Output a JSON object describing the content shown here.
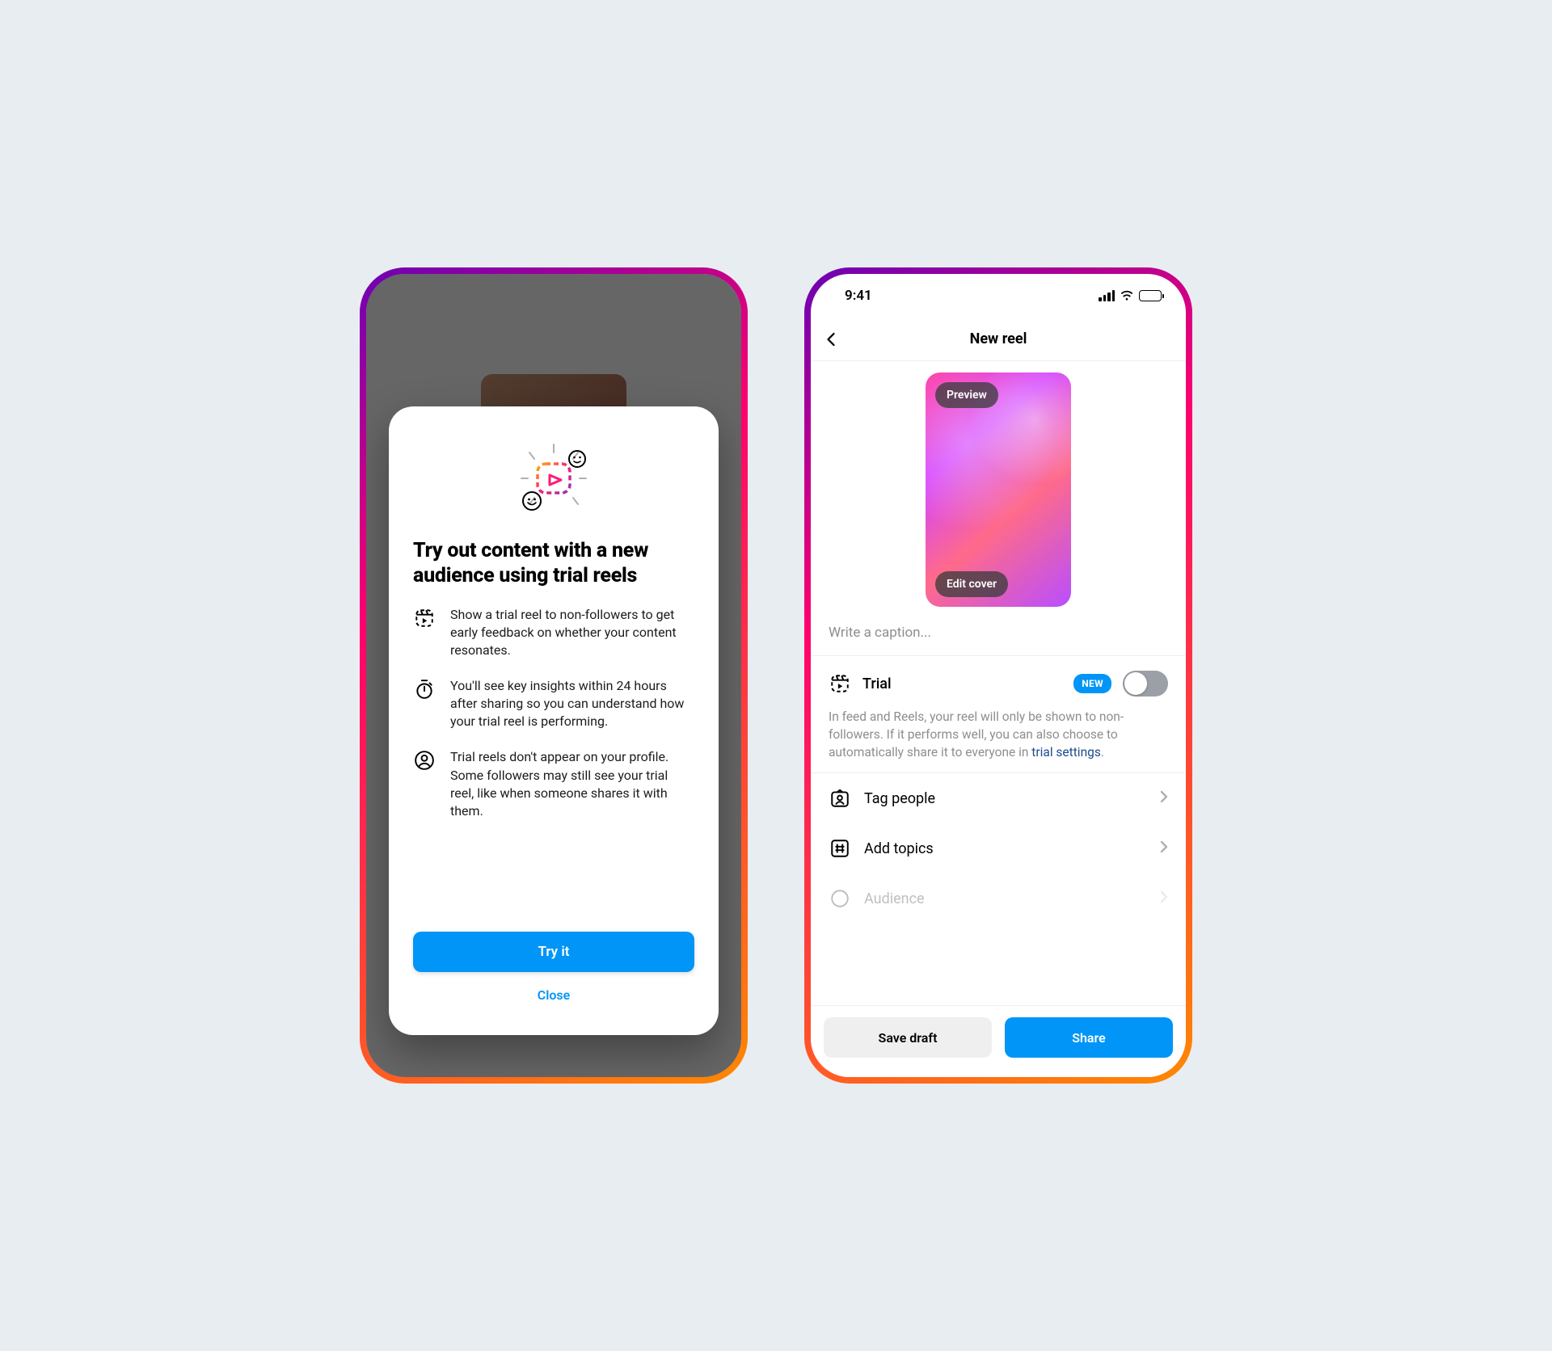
{
  "status": {
    "time": "9:41"
  },
  "nav": {
    "title": "New reel"
  },
  "modal": {
    "title": "Try out content with a new audience using trial reels",
    "bullets": [
      "Show a trial reel to non-followers to get early feedback on whether your content resonates.",
      "You'll see key insights within 24 hours after sharing so you can understand how your trial reel is performing.",
      "Trial reels don't appear on your profile. Some followers may still see your trial reel, like when someone shares it with them."
    ],
    "try_label": "Try it",
    "close_label": "Close"
  },
  "cover": {
    "preview_label": "Preview",
    "edit_label": "Edit cover"
  },
  "caption_placeholder": "Write a caption...",
  "trial": {
    "label": "Trial",
    "badge": "NEW",
    "description_pre": "In feed and Reels, your reel will only be shown to non-followers. If it performs well, you can also choose to automatically share it to everyone in ",
    "link_text": "trial settings",
    "description_post": "."
  },
  "rows": {
    "tag_people": "Tag people",
    "add_topics": "Add topics",
    "audience": "Audience"
  },
  "buttons": {
    "save_draft": "Save draft",
    "share": "Share"
  }
}
